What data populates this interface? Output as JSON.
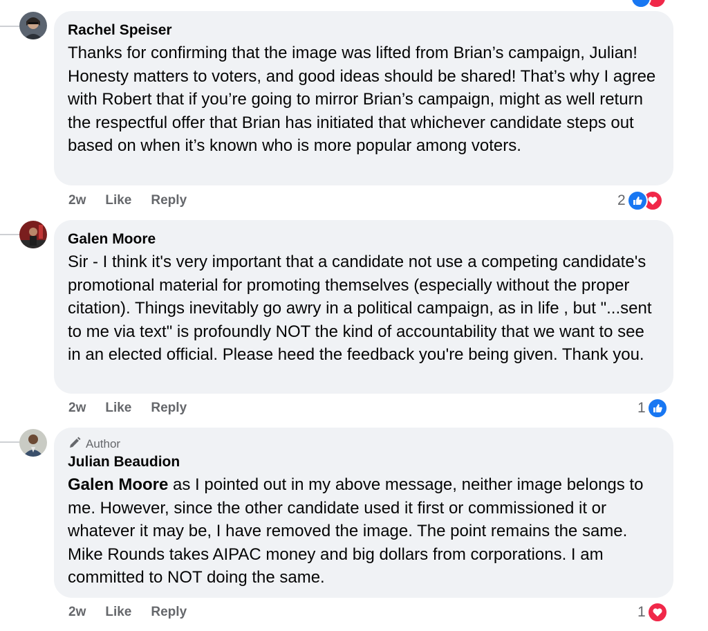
{
  "comments": [
    {
      "name": "Rachel Speiser",
      "author_badge": "",
      "body": "Thanks for confirming that the image was lifted from Brian’s campaign, Julian! Honesty matters to voters, and good ideas should be shared! That’s why I agree with Robert that if you’re going to mirror Brian’s campaign, might as well return the respectful offer that Brian has initiated that whichever candidate steps out based on when it’s known who is more popular among voters.",
      "age": "2w",
      "like_label": "Like",
      "reply_label": "Reply",
      "reaction_count": "2",
      "reactions": [
        "like-icon",
        "love-icon"
      ]
    },
    {
      "name": "Galen Moore",
      "author_badge": "",
      "body": "Sir - I think it's very important that a candidate not use a competing candidate's promotional material for promoting themselves (especially without the proper citation). Things inevitably go awry in a political campaign, as in life , but \"...sent to me via text\" is profoundly NOT the kind of accountability that we want to see in an elected official. Please heed the feedback you're being given. Thank you.",
      "age": "2w",
      "like_label": "Like",
      "reply_label": "Reply",
      "reaction_count": "1",
      "reactions": [
        "like-icon"
      ]
    },
    {
      "name": "Julian Beaudion",
      "author_badge": "Author",
      "mention": "Galen Moore",
      "body": " as I pointed out in my above message, neither image belongs to me. However, since the other candidate used it first or commissioned it or whatever it may be, I have removed the image. The point remains the same. Mike Rounds takes AIPAC money and big dollars from corporations. I am committed to NOT doing the same.",
      "age": "2w",
      "like_label": "Like",
      "reply_label": "Reply",
      "reaction_count": "1",
      "reactions": [
        "love-icon"
      ]
    }
  ],
  "colors": {
    "bubble": "#f0f2f5",
    "like": "#1877f2",
    "love": "#f02849",
    "meta": "#65676b"
  }
}
